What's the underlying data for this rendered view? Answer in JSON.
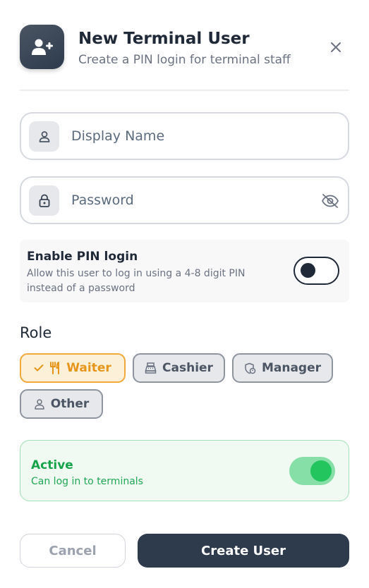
{
  "header": {
    "title": "New Terminal User",
    "subtitle": "Create a PIN login for terminal staff",
    "icon": "user-plus-icon",
    "close_icon": "close-icon"
  },
  "form": {
    "display_name": {
      "placeholder": "Display Name",
      "value": "",
      "icon": "user-icon"
    },
    "password": {
      "placeholder": "Password",
      "value": "",
      "icon": "lock-icon",
      "visibility_icon": "eye-off-icon"
    }
  },
  "pin_login": {
    "title": "Enable PIN login",
    "description": "Allow this user to log in using a 4-8 digit PIN instead of a password",
    "enabled": false
  },
  "role": {
    "title": "Role",
    "selected": "Waiter",
    "options": [
      {
        "label": "Waiter",
        "icon": "utensils-icon",
        "selected": true
      },
      {
        "label": "Cashier",
        "icon": "cash-register-icon",
        "selected": false
      },
      {
        "label": "Manager",
        "icon": "shield-user-icon",
        "selected": false
      },
      {
        "label": "Other",
        "icon": "user-icon",
        "selected": false
      }
    ]
  },
  "active": {
    "title": "Active",
    "subtitle": "Can log in to terminals",
    "enabled": true
  },
  "actions": {
    "cancel_label": "Cancel",
    "create_label": "Create User"
  },
  "colors": {
    "primary": "#2d3b4d",
    "accent_selected": "#f2a93b",
    "success": "#22c55e"
  }
}
